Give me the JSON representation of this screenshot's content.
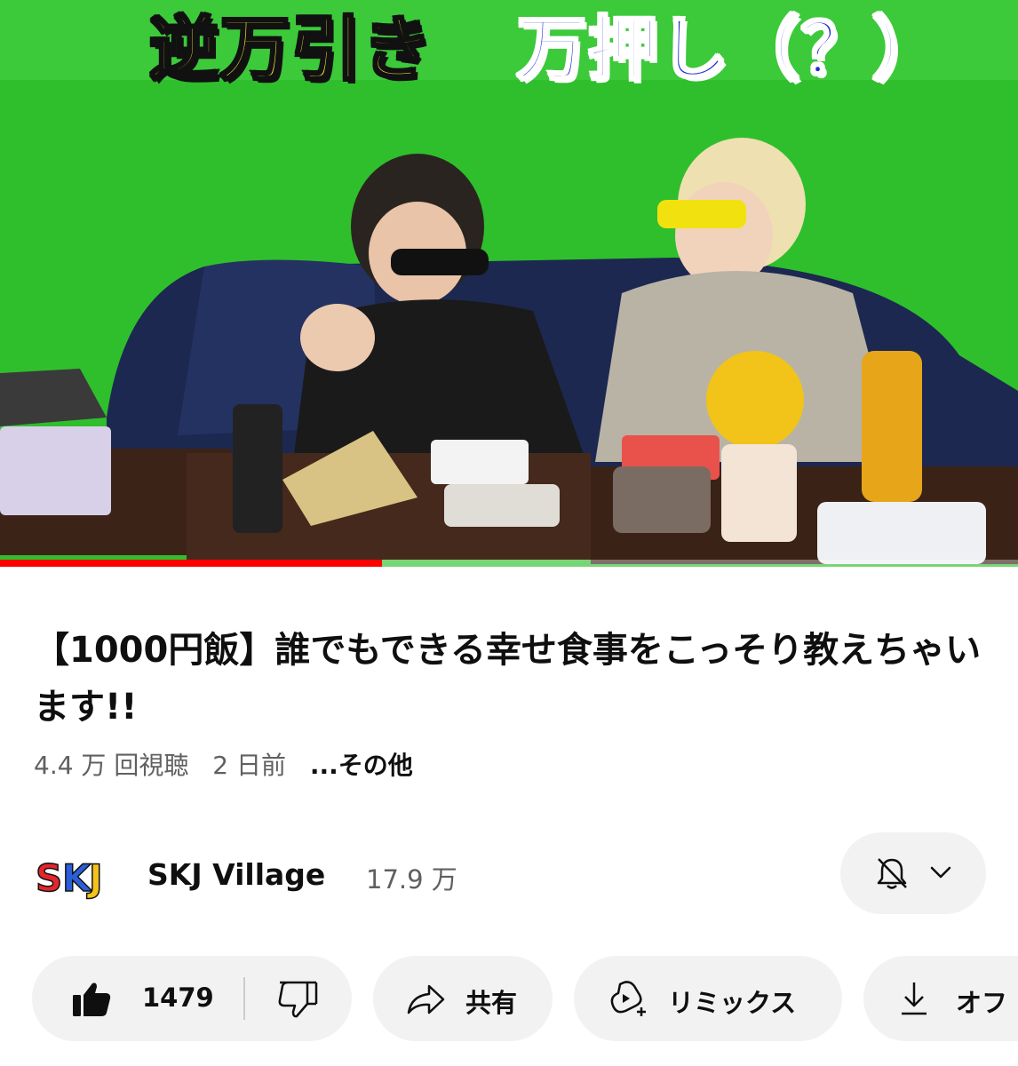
{
  "video": {
    "caption_left": "逆万引き",
    "caption_right": "万押し（？）",
    "progress": 0.375
  },
  "title": "【1000円飯】誰でもできる幸せ食事をこっそり教えちゃいます!!",
  "meta": {
    "views": "4.4 万 回視聴",
    "age": "2 日前",
    "more": "...その他"
  },
  "channel": {
    "logo_text": "SKJ",
    "name": "SKJ Village",
    "subscribers": "17.9 万",
    "icons": {
      "bell": "bell-off-icon",
      "chevron": "chevron-down-icon"
    }
  },
  "actions": {
    "like_count": "1479",
    "share_label": "共有",
    "remix_label": "リミックス",
    "offline_label": "オフ",
    "icons": [
      "thumbs-up-icon",
      "thumbs-down-icon",
      "share-icon",
      "remix-icon",
      "download-icon"
    ]
  },
  "colors": {
    "progress": "#ff0000",
    "pill_bg": "#f2f2f2",
    "meta_text": "#606060",
    "caption_yellow": "#f6ec3a",
    "caption_blue": "#1f2bd8"
  }
}
